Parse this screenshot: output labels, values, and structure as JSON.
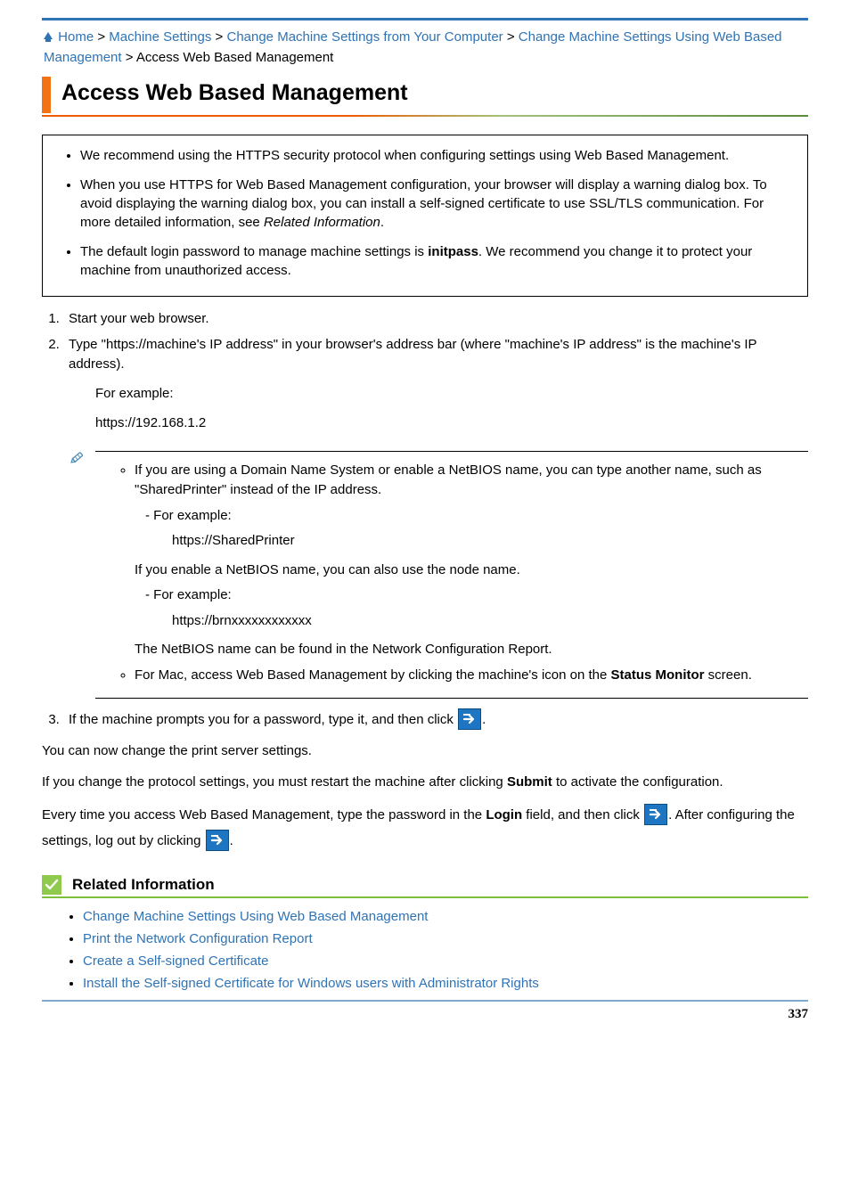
{
  "breadcrumb": {
    "home": "Home",
    "sep": ">",
    "l1": "Machine Settings",
    "l2": "Change Machine Settings from Your Computer",
    "l3": "Change Machine Settings Using Web Based Management",
    "current": "Access Web Based Management"
  },
  "headline": "Access Web Based Management",
  "notes": {
    "n1": "We recommend using the HTTPS security protocol when configuring settings using Web Based Management.",
    "n2_a": "When you use HTTPS for Web Based Management configuration, your browser will display a warning dialog box. To avoid displaying the warning dialog box, you can install a self-signed certificate to use SSL/TLS communication. For more detailed information, see ",
    "n2_em": "Related Information",
    "n2_b": ".",
    "n3_a": "The default login password to manage machine settings is ",
    "n3_strong": "initpass",
    "n3_b": ". We recommend you change it to protect your machine from unauthorized access."
  },
  "steps": {
    "s1": "Start your web browser.",
    "s2": "Type \"https://machine's IP address\" in your browser's address bar (where \"machine's IP address\" is the machine's IP address).",
    "s2_eg_label": "For example:",
    "s2_eg": "https://192.168.1.2",
    "tip1": "If you are using a Domain Name System or enable a NetBIOS name, you can type another name, such as \"SharedPrinter\" instead of the IP address.",
    "tip1_eg_label": "For example:",
    "tip1_eg": "https://SharedPrinter",
    "tip2": "If you enable a NetBIOS name, you can also use the node name.",
    "tip2_eg_label": "For example:",
    "tip2_eg": "https://brnxxxxxxxxxxxx",
    "tip3": "The NetBIOS name can be found in the Network Configuration Report.",
    "tip4_a": "For Mac, access Web Based Management by clicking the machine's icon on the ",
    "tip4_strong": "Status Monitor",
    "tip4_b": " screen.",
    "s3_a": "If the machine prompts you for a password, type it, and then click ",
    "s3_b": "."
  },
  "body": {
    "p1": "You can now change the print server settings.",
    "p2_a": "If you change the protocol settings, you must restart the machine after clicking ",
    "p2_strong": "Submit",
    "p2_b": " to activate the configuration.",
    "p3_a": "Every time you access Web Based Management, type the password in the ",
    "p3_strong": "Login",
    "p3_b": " field, and then click ",
    "p3_c": ". After configuring the settings, log out by clicking ",
    "p3_d": "."
  },
  "related": {
    "title": "Related Information",
    "items": [
      "Change Machine Settings Using Web Based Management",
      "Print the Network Configuration Report",
      "Create a Self-signed Certificate",
      "Install the Self-signed Certificate for Windows users with Administrator Rights"
    ]
  },
  "pagenum": "337"
}
